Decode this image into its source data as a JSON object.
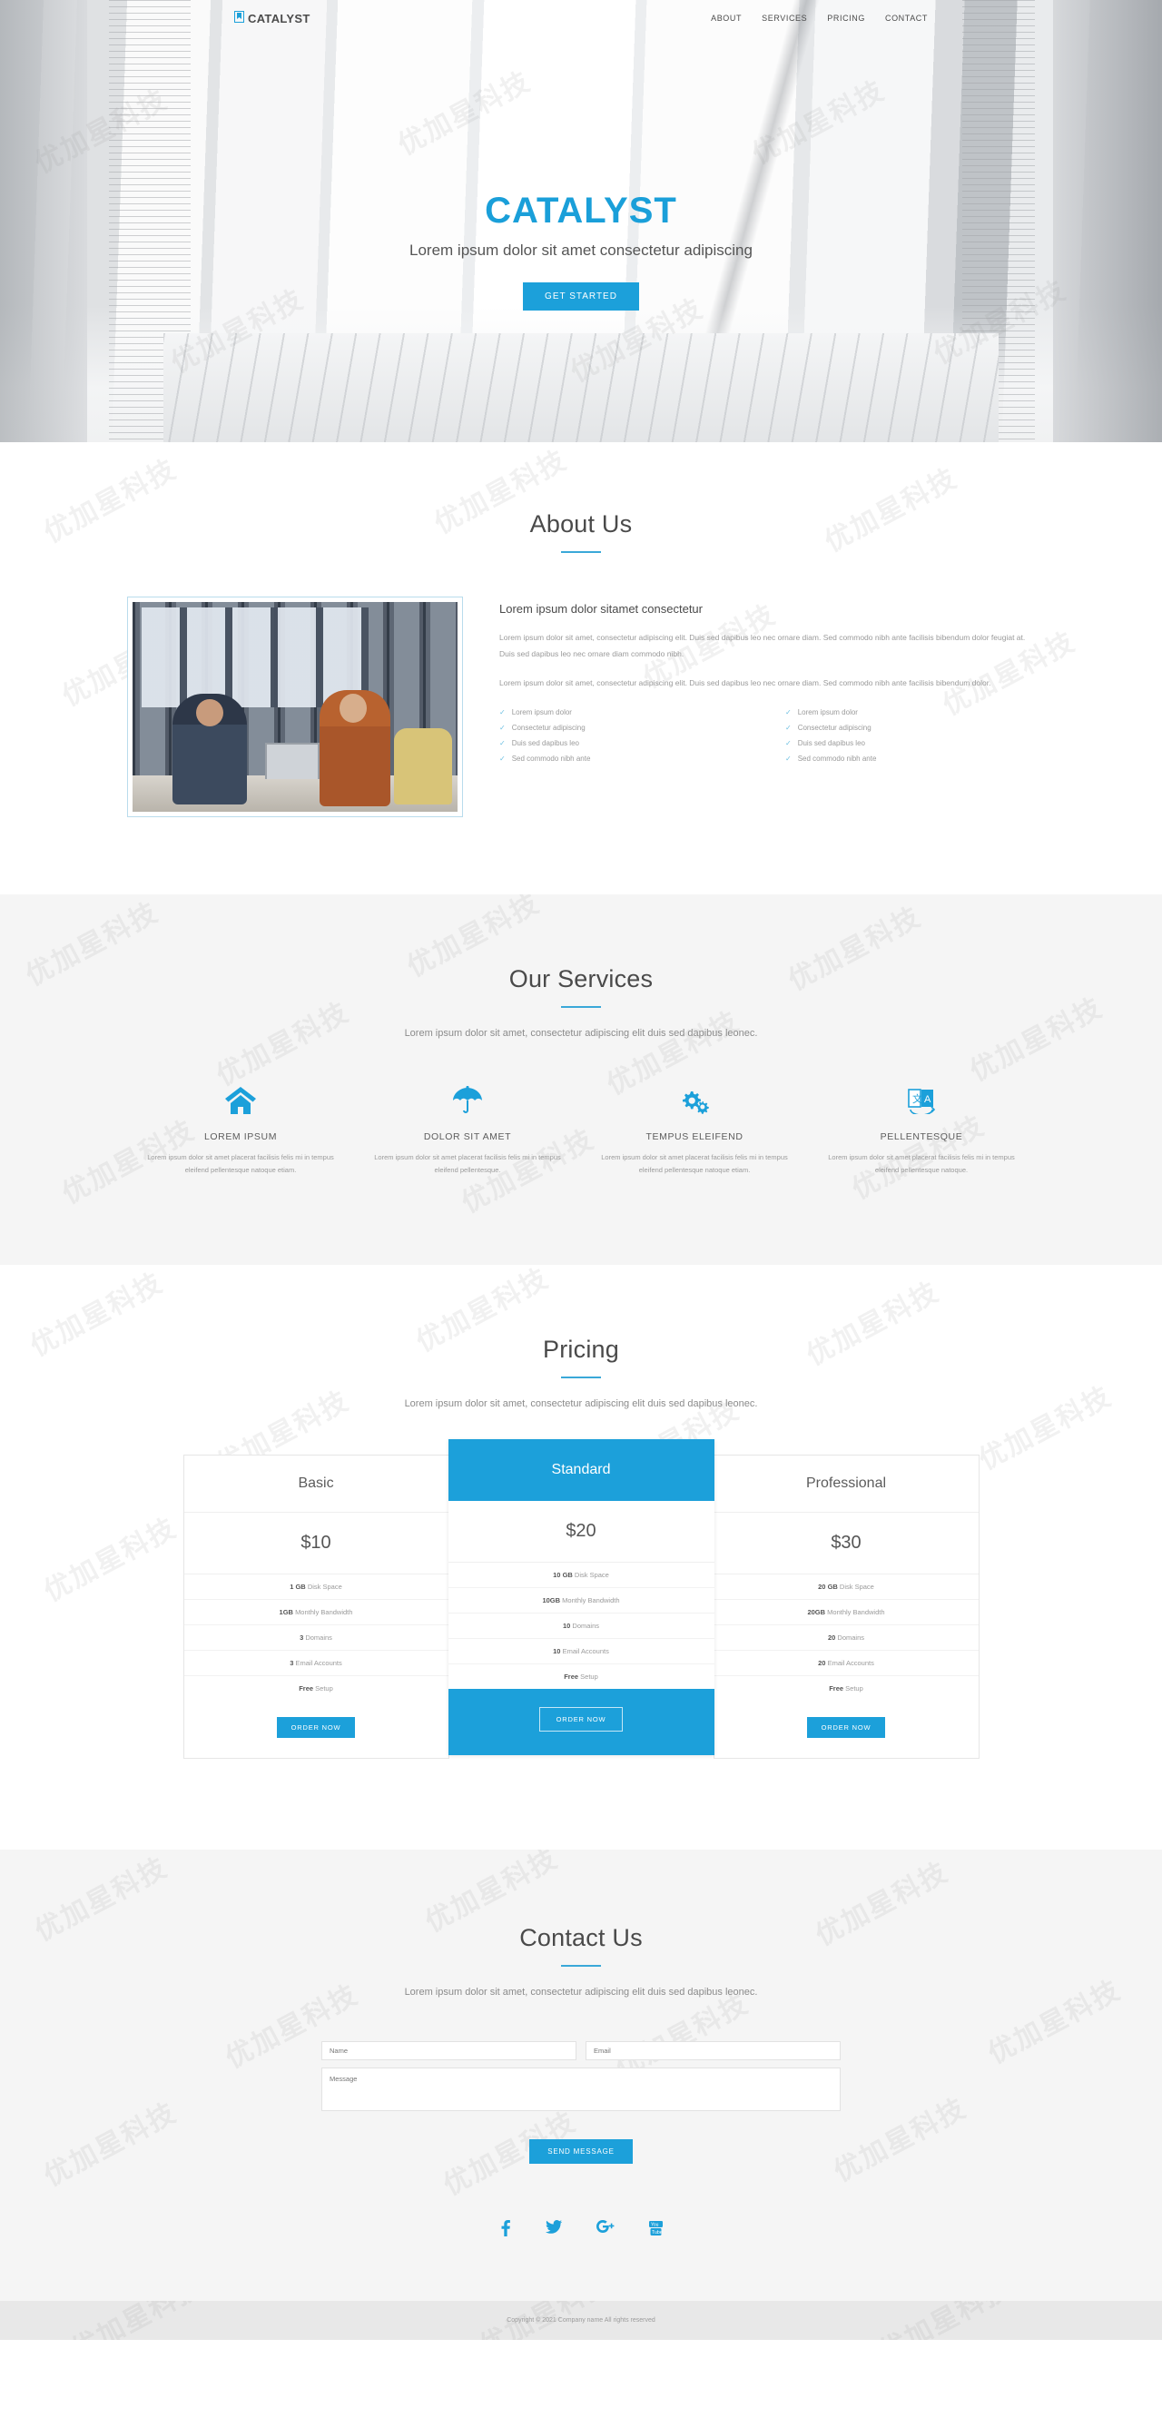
{
  "brand": {
    "name": "CATALYST",
    "icon": "bookmark-icon",
    "accent": "#1ca0da"
  },
  "nav": {
    "items": [
      "ABOUT",
      "SERVICES",
      "PRICING",
      "CONTACT"
    ]
  },
  "hero": {
    "title": "CATALYST",
    "subtitle": "Lorem ipsum dolor sit amet consectetur adipiscing",
    "cta": "GET STARTED"
  },
  "about": {
    "title": "About Us",
    "heading": "Lorem ipsum dolor sitamet consectetur",
    "paragraph1": "Lorem ipsum dolor sit amet, consectetur adipiscing elit. Duis sed dapibus leo nec ornare diam. Sed commodo nibh ante facilisis bibendum dolor feugiat at. Duis sed dapibus leo nec ornare diam commodo nibh.",
    "paragraph2": "Lorem ipsum dolor sit amet, consectetur adipiscing elit. Duis sed dapibus leo nec ornare diam. Sed commodo nibh ante facilisis bibendum dolor.",
    "list_left": [
      "Lorem ipsum dolor",
      "Consectetur adipiscing",
      "Duis sed dapibus leo",
      "Sed commodo nibh ante"
    ],
    "list_right": [
      "Lorem ipsum dolor",
      "Consectetur adipiscing",
      "Duis sed dapibus leo",
      "Sed commodo nibh ante"
    ],
    "image_alt": "two-people-at-laptop-photo"
  },
  "services": {
    "title": "Our Services",
    "lead": "Lorem ipsum dolor sit amet, consectetur adipiscing elit duis sed dapibus leonec.",
    "items": [
      {
        "icon": "home-icon",
        "name": "LOREM IPSUM",
        "text": "Lorem ipsum dolor sit amet placerat facilisis felis mi in tempus eleifend pellentesque natoque etiam."
      },
      {
        "icon": "umbrella-icon",
        "name": "DOLOR SIT AMET",
        "text": "Lorem ipsum dolor sit amet placerat facilisis felis mi in tempus eleifend pellentesque."
      },
      {
        "icon": "gears-icon",
        "name": "TEMPUS ELEIFEND",
        "text": "Lorem ipsum dolor sit amet placerat facilisis felis mi in tempus eleifend pellentesque natoque etiam."
      },
      {
        "icon": "language-icon",
        "name": "PELLENTESQUE",
        "text": "Lorem ipsum dolor sit amet placerat facilisis felis mi in tempus eleifend pellentesque natoque."
      }
    ]
  },
  "pricing": {
    "title": "Pricing",
    "lead": "Lorem ipsum dolor sit amet, consectetur adipiscing elit duis sed dapibus leonec.",
    "plans": [
      {
        "name": "Basic",
        "price": "$10",
        "featured": false,
        "cta": "ORDER NOW",
        "features": [
          {
            "value": "1 GB",
            "label": "Disk Space"
          },
          {
            "value": "1GB",
            "label": "Monthly Bandwidth"
          },
          {
            "value": "3",
            "label": "Domains"
          },
          {
            "value": "3",
            "label": "Email Accounts"
          },
          {
            "value": "Free",
            "label": "Setup"
          }
        ]
      },
      {
        "name": "Standard",
        "price": "$20",
        "featured": true,
        "cta": "ORDER NOW",
        "features": [
          {
            "value": "10 GB",
            "label": "Disk Space"
          },
          {
            "value": "10GB",
            "label": "Monthly Bandwidth"
          },
          {
            "value": "10",
            "label": "Domains"
          },
          {
            "value": "10",
            "label": "Email Accounts"
          },
          {
            "value": "Free",
            "label": "Setup"
          }
        ]
      },
      {
        "name": "Professional",
        "price": "$30",
        "featured": false,
        "cta": "ORDER NOW",
        "features": [
          {
            "value": "20 GB",
            "label": "Disk Space"
          },
          {
            "value": "20GB",
            "label": "Monthly Bandwidth"
          },
          {
            "value": "20",
            "label": "Domains"
          },
          {
            "value": "20",
            "label": "Email Accounts"
          },
          {
            "value": "Free",
            "label": "Setup"
          }
        ]
      }
    ]
  },
  "contact": {
    "title": "Contact Us",
    "lead": "Lorem ipsum dolor sit amet, consectetur adipiscing elit duis sed dapibus leonec.",
    "name_placeholder": "Name",
    "name_value": "",
    "email_placeholder": "Email",
    "email_value": "",
    "message_placeholder": "Message",
    "message_value": "",
    "submit": "SEND MESSAGE",
    "social": [
      "facebook-icon",
      "twitter-icon",
      "google-plus-icon",
      "youtube-icon"
    ]
  },
  "footer": {
    "copyright": "Copyright © 2021 Company name All rights reserved"
  },
  "watermark": {
    "text": "优加星科技"
  }
}
